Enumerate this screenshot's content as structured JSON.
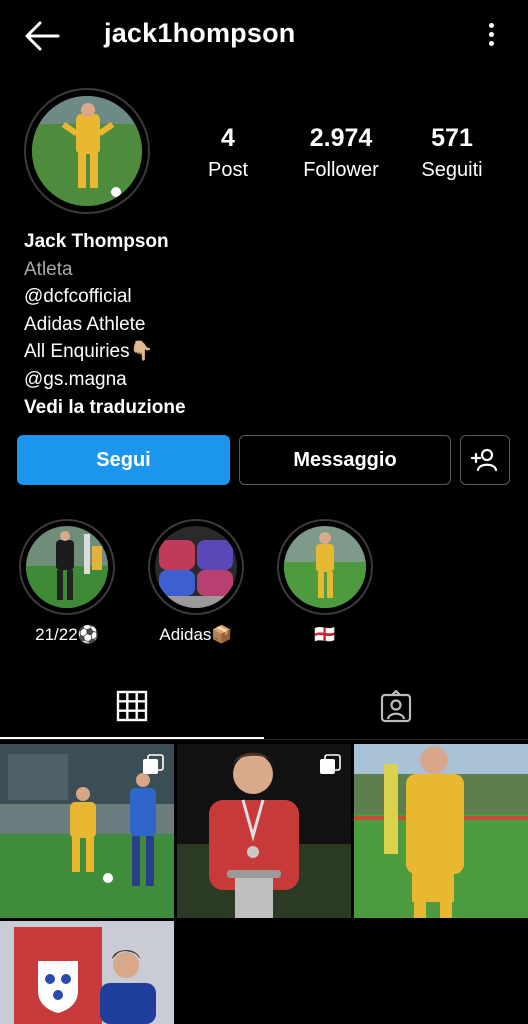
{
  "header": {
    "username": "jack1hompson"
  },
  "stats": [
    {
      "value": "4",
      "label": "Post"
    },
    {
      "value": "2.974",
      "label": "Follower"
    },
    {
      "value": "571",
      "label": "Seguiti"
    }
  ],
  "bio": {
    "name": "Jack Thompson",
    "category": "Atleta",
    "lines": [
      "@dcfcofficial",
      "Adidas Athlete",
      "All Enquiries👇🏼",
      "@gs.magna"
    ],
    "translate": "Vedi la traduzione"
  },
  "actions": {
    "follow": "Segui",
    "message": "Messaggio"
  },
  "highlights": [
    {
      "label": "21/22⚽"
    },
    {
      "label": "Adidas📦"
    },
    {
      "label": "🏴󠁧󠁢󠁥󠁮󠁧󠁿"
    }
  ],
  "colors": {
    "accent": "#1c95ef",
    "background": "#000000"
  }
}
